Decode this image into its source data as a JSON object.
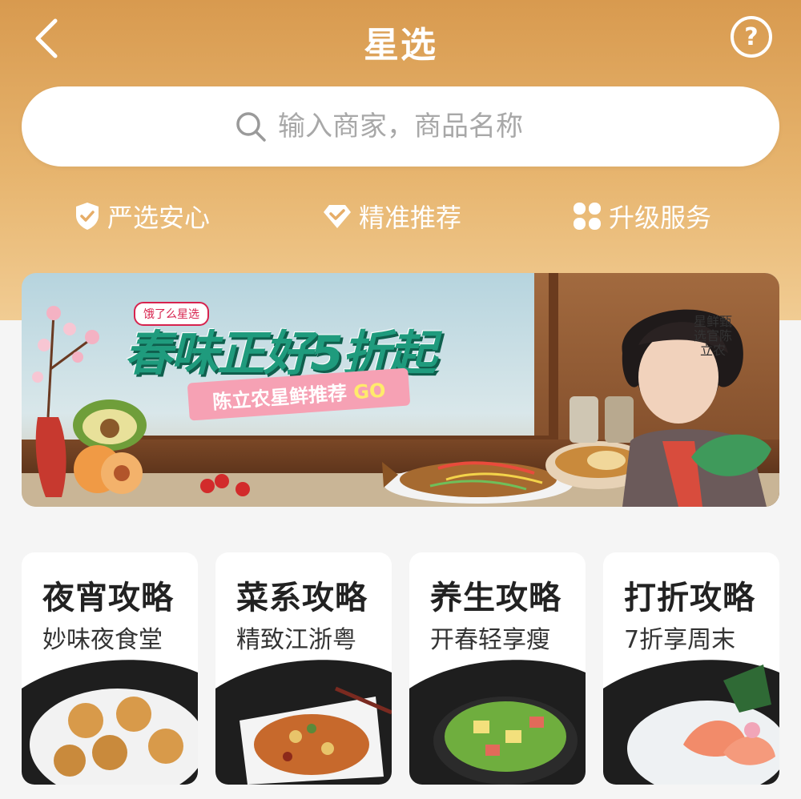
{
  "header": {
    "title": "星选"
  },
  "search": {
    "placeholder": "输入商家，商品名称"
  },
  "features": [
    {
      "label": "严选安心",
      "icon": "shield-check-icon"
    },
    {
      "label": "精准推荐",
      "icon": "diamond-check-icon"
    },
    {
      "label": "升级服务",
      "icon": "clover-icon"
    }
  ],
  "banner": {
    "brand": "饿了么星选",
    "headline": "春味正好5折起",
    "sub_label": "陈立农星鲜推荐",
    "go": "GO",
    "tag": "星鲜甄选官陈立农"
  },
  "cards": [
    {
      "title": "夜宵攻略",
      "subtitle": "妙味夜食堂"
    },
    {
      "title": "菜系攻略",
      "subtitle": "精致江浙粤"
    },
    {
      "title": "养生攻略",
      "subtitle": "开春轻享瘦"
    },
    {
      "title": "打折攻略",
      "subtitle": "7折享周末"
    }
  ],
  "colors": {
    "header_gradient_top": "#d89a4f",
    "header_gradient_bottom": "#f1cc93",
    "headline_green": "#1f9b7d",
    "sub_pink": "#f6a1b4"
  }
}
